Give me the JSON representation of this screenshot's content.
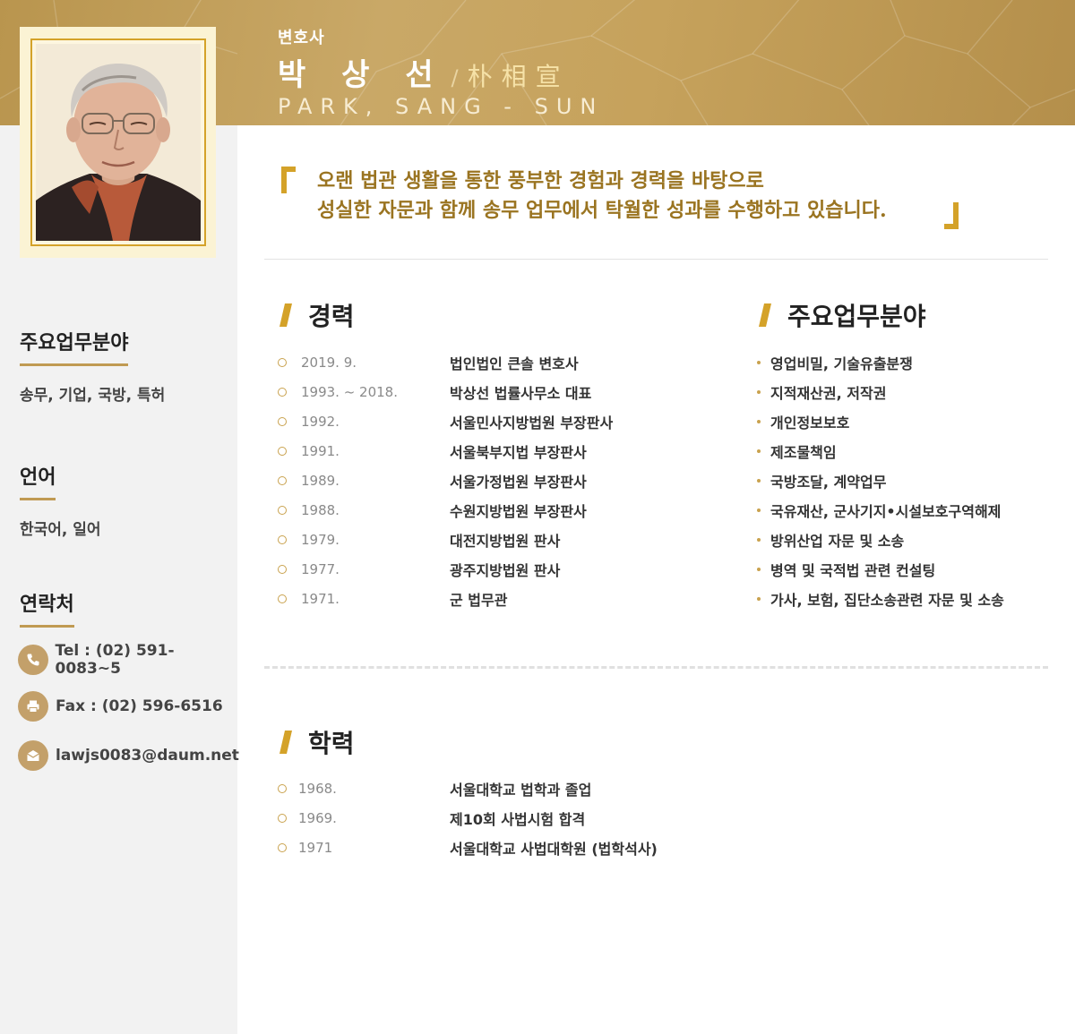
{
  "profile": {
    "role": "변호사",
    "name_kr": "박 상 선",
    "name_slash": "/",
    "name_hanja": "朴相宣",
    "name_en": "PARK, SANG - SUN"
  },
  "quote": {
    "line1": "오랜 법관 생활을 통한 풍부한 경험과 경력을 바탕으로",
    "line2": "성실한 자문과 함께 송무 업무에서 탁월한 성과를 수행하고 있습니다."
  },
  "sidebar": {
    "practice": {
      "title": "주요업무분야",
      "text": "송무, 기업, 국방, 특허"
    },
    "language": {
      "title": "언어",
      "text": "한국어, 일어"
    },
    "contact": {
      "title": "연락처",
      "tel": "Tel : (02) 591-0083~5",
      "fax": "Fax : (02) 596-6516",
      "email": "lawjs0083@daum.net"
    }
  },
  "career": {
    "title": "경력",
    "items": [
      {
        "year": "2019. 9.",
        "desc": "법인법인 큰솔 변호사"
      },
      {
        "year": "1993. ~ 2018.",
        "desc": "박상선 법률사무소 대표"
      },
      {
        "year": "1992.",
        "desc": "서울민사지방법원 부장판사"
      },
      {
        "year": "1991.",
        "desc": "서울북부지법 부장판사"
      },
      {
        "year": "1989.",
        "desc": "서울가정법원 부장판사"
      },
      {
        "year": "1988.",
        "desc": "수원지방법원 부장판사"
      },
      {
        "year": "1979.",
        "desc": "대전지방법원 판사"
      },
      {
        "year": "1977.",
        "desc": "광주지방법원 판사"
      },
      {
        "year": "1971.",
        "desc": "군 법무관"
      }
    ]
  },
  "practice_areas": {
    "title": "주요업무분야",
    "items": [
      "영업비밀, 기술유출분쟁",
      "지적재산권, 저작권",
      "개인정보보호",
      "제조물책임",
      "국방조달, 계약업무",
      "국유재산, 군사기지•시설보호구역해제",
      "방위산업 자문 및 소송",
      "병역 및 국적법 관련 컨설팅",
      "가사, 보험, 집단소송관련 자문 및 소송"
    ]
  },
  "education": {
    "title": "학력",
    "items": [
      {
        "year": "1968.",
        "desc": "서울대학교 법학과 졸업"
      },
      {
        "year": "1969.",
        "desc": "제10회 사법시험 합격"
      },
      {
        "year": "1971",
        "desc": "서울대학교 사법대학원 (법학석사)"
      }
    ]
  },
  "colors": {
    "gold": "#c09a52",
    "accent": "#d4a229",
    "quote_text": "#9a7421"
  },
  "icons": [
    "phone-icon",
    "fax-icon",
    "email-icon",
    "slash-mark-icon",
    "quote-bracket-icon"
  ]
}
